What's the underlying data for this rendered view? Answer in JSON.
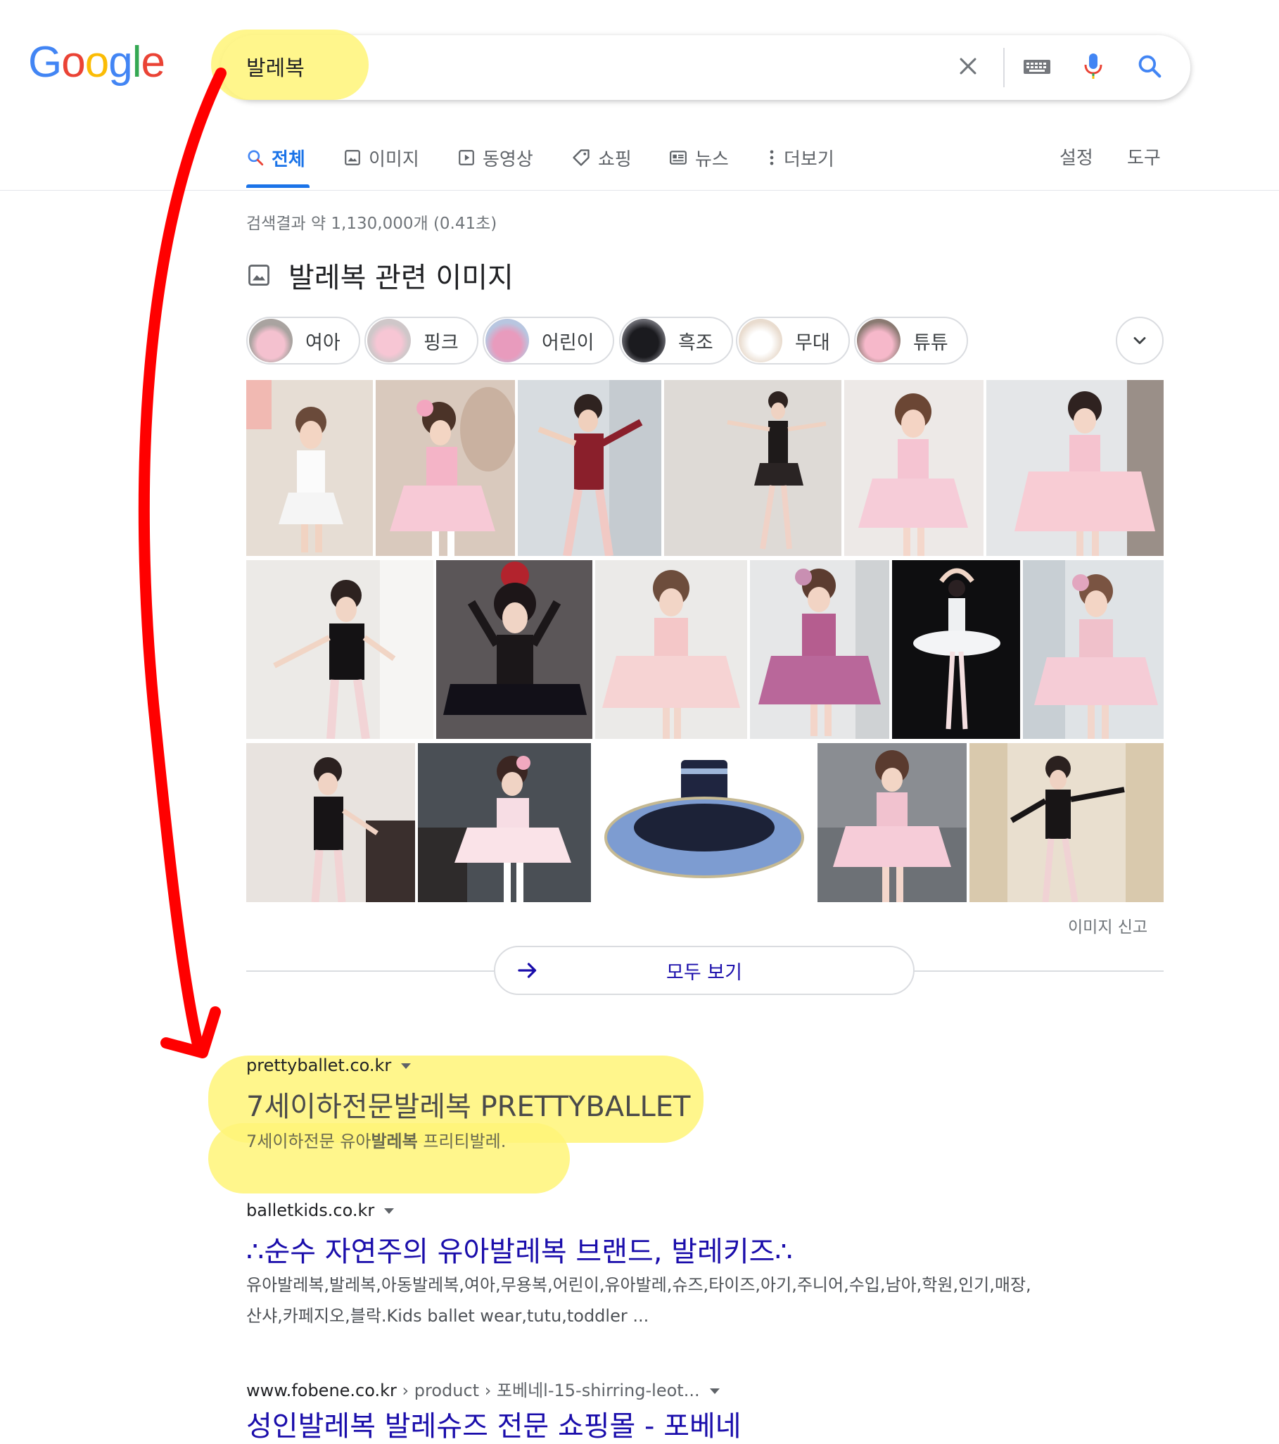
{
  "logo": {
    "letters": [
      "G",
      "o",
      "o",
      "g",
      "l",
      "e"
    ],
    "colors": [
      "#4285F4",
      "#EA4335",
      "#FBBC05",
      "#4285F4",
      "#34A853",
      "#EA4335"
    ]
  },
  "search": {
    "query": "발레복"
  },
  "tabs": [
    {
      "label": "전체",
      "icon": "search-icon",
      "active": true
    },
    {
      "label": "이미지",
      "icon": "image-icon"
    },
    {
      "label": "동영상",
      "icon": "video-icon"
    },
    {
      "label": "쇼핑",
      "icon": "tag-icon"
    },
    {
      "label": "뉴스",
      "icon": "news-icon"
    },
    {
      "label": "더보기",
      "icon": "more-icon"
    }
  ],
  "tools": {
    "settings": "설정",
    "tools": "도구"
  },
  "stats": "검색결과 약 1,130,000개 (0.41초)",
  "images_section": {
    "title": "발레복 관련 이미지",
    "chips": [
      "여아",
      "핑크",
      "어린이",
      "흑조",
      "무대",
      "튜튜"
    ],
    "report": "이미지 신고",
    "see_all": "모두 보기"
  },
  "results": [
    {
      "site": "prettyballet.co.kr",
      "title": "7세이하전문발레복 PRETTYBALLET",
      "snippet_pre": "7세이하전문 유아",
      "snippet_bold": "발레복",
      "snippet_post": " 프리티발레."
    },
    {
      "site": "balletkids.co.kr",
      "title": "∴순수 자연주의 유아발레복 브랜드, 발레키즈∴",
      "snippet_line1": "유아발레복,발레복,아동발레복,여아,무용복,어린이,유아발레,슈즈,타이즈,아기,주니어,수입,남아,학원,인기,매장,",
      "snippet_line2": "산샤,카페지오,블락.Kids ballet wear,tutu,toddler ..."
    },
    {
      "site": "www.fobene.co.kr",
      "path": " › product › 포베네l-15-shirring-leot...",
      "title": "성인발레복 발레슈즈 전문 쇼핑몰 - 포베네"
    }
  ],
  "colors": {
    "accent": "#1a73e8",
    "link": "#1a0dab",
    "highlight": "#fff478",
    "annotation_arrow": "#ff0000"
  }
}
